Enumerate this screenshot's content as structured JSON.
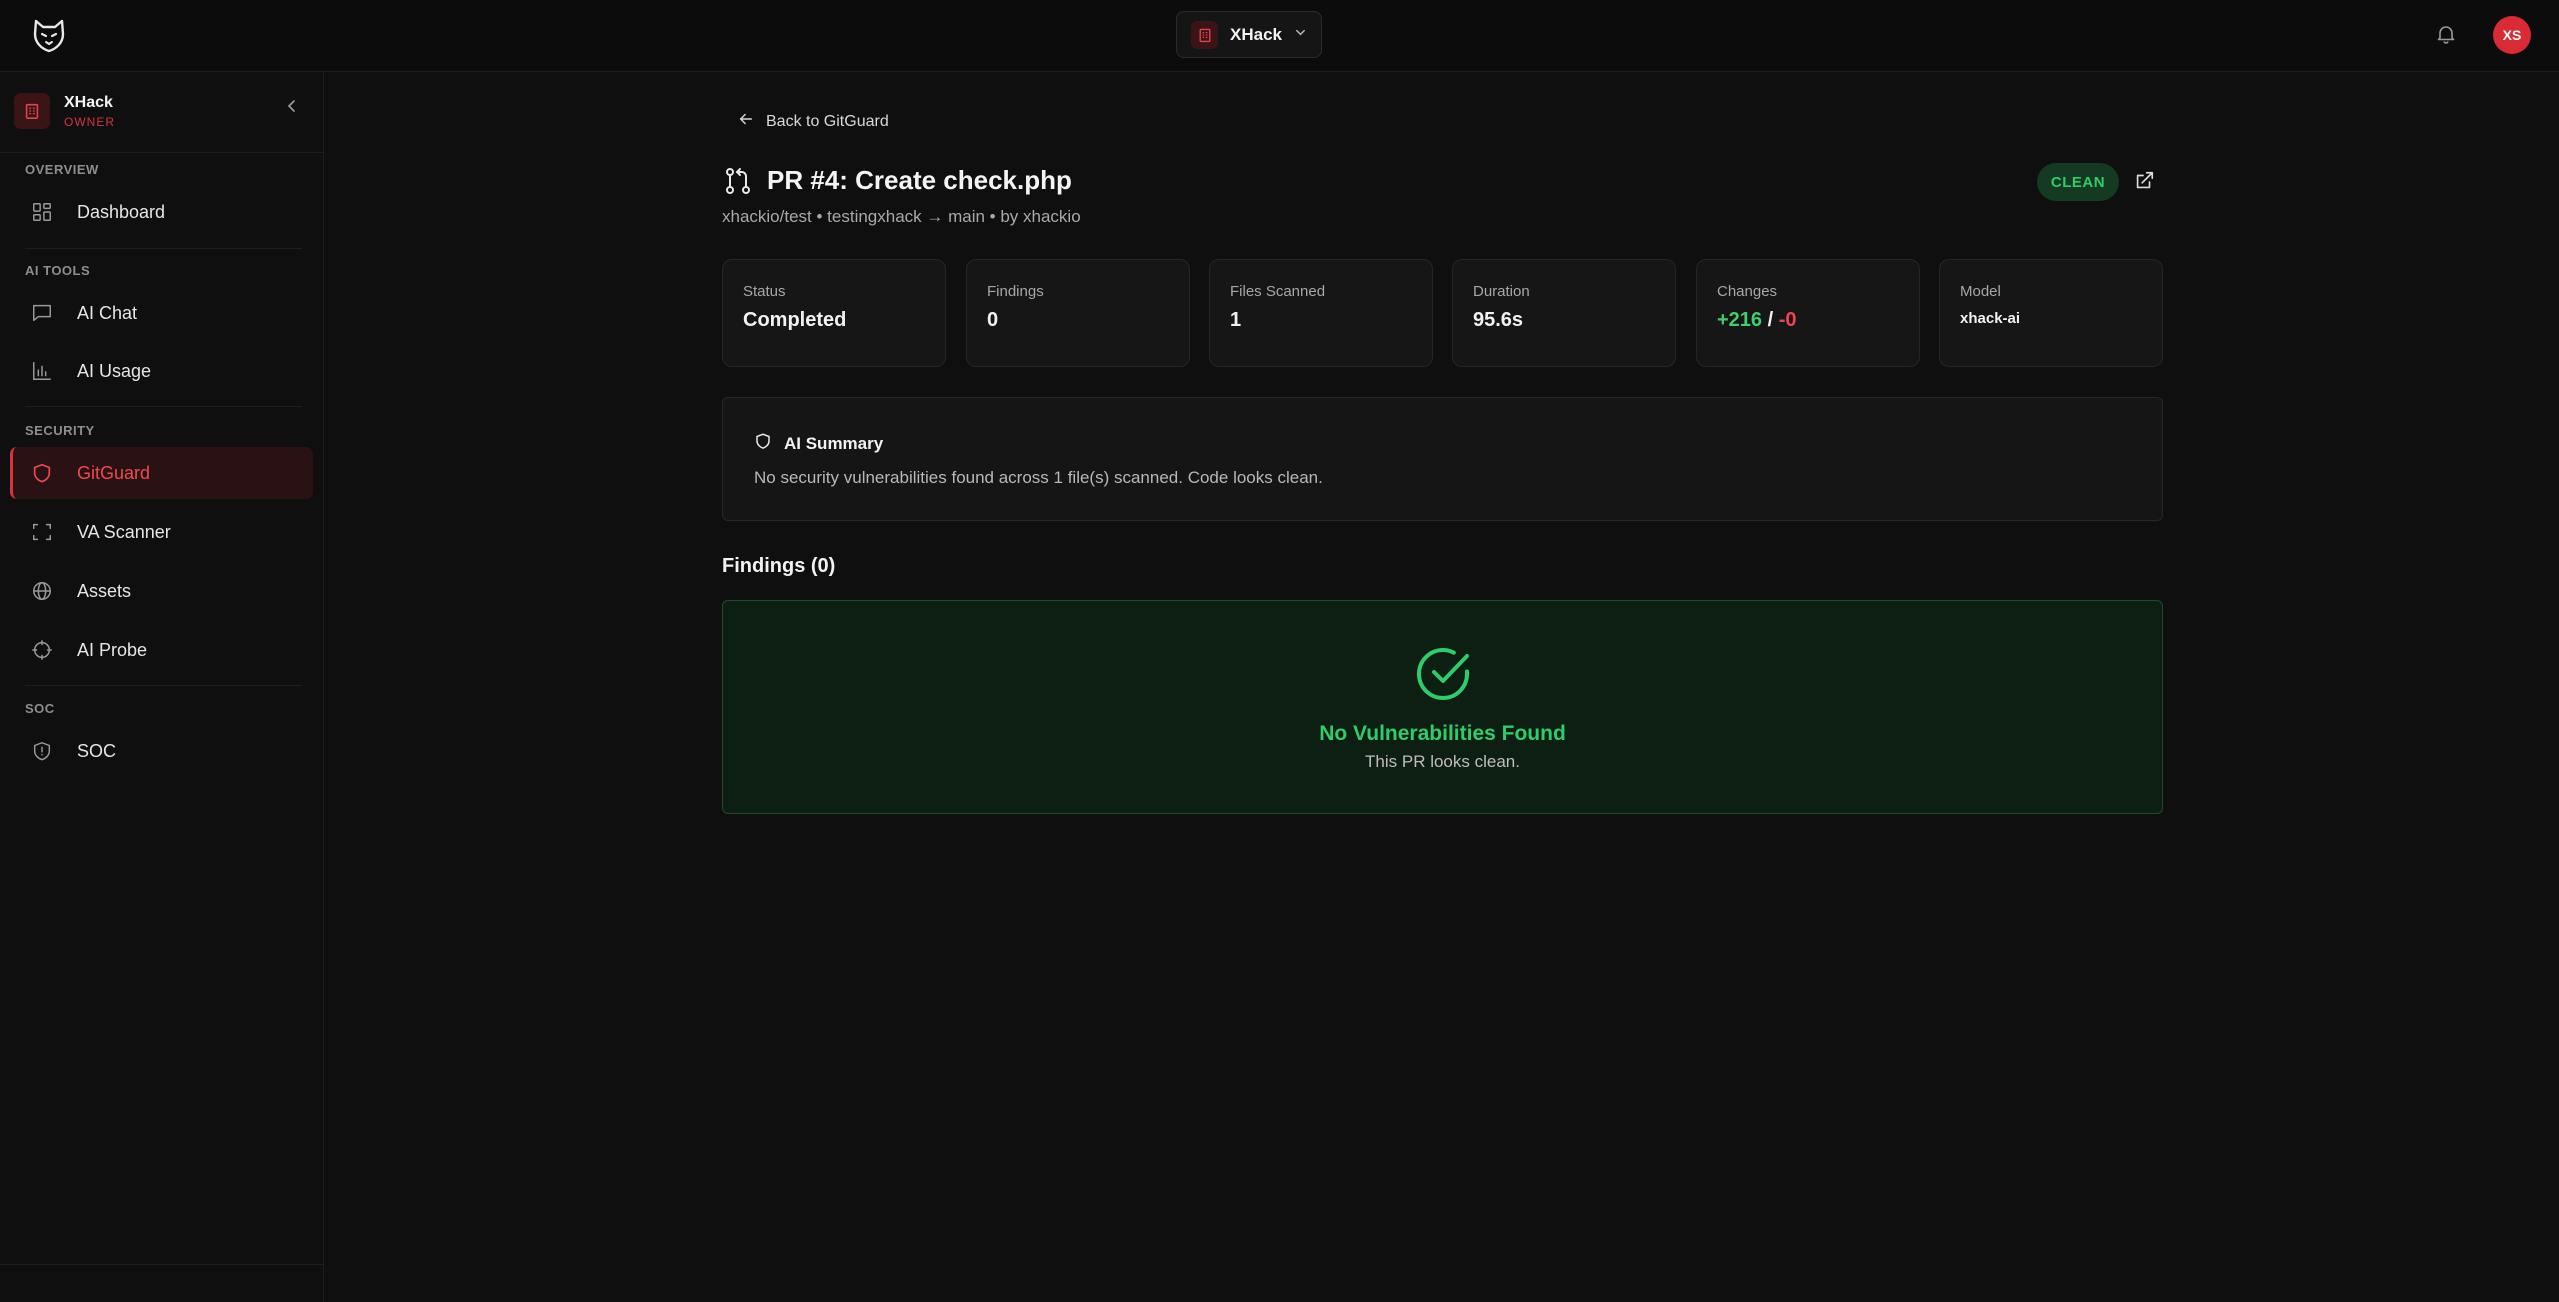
{
  "header": {
    "org_switcher": {
      "name": "XHack"
    },
    "user_initials": "XS"
  },
  "sidebar": {
    "workspace": {
      "name": "XHack",
      "role": "OWNER"
    },
    "sections": [
      {
        "label": "OVERVIEW",
        "items": [
          {
            "label": "Dashboard",
            "icon": "grid-icon"
          }
        ]
      },
      {
        "label": "AI TOOLS",
        "items": [
          {
            "label": "AI Chat",
            "icon": "chat-icon"
          },
          {
            "label": "AI Usage",
            "icon": "bar-chart-icon"
          }
        ]
      },
      {
        "label": "SECURITY",
        "items": [
          {
            "label": "GitGuard",
            "icon": "shield-icon",
            "active": true
          },
          {
            "label": "VA Scanner",
            "icon": "scan-icon"
          },
          {
            "label": "Assets",
            "icon": "globe-icon"
          },
          {
            "label": "AI Probe",
            "icon": "crosshair-icon"
          }
        ]
      },
      {
        "label": "SOC",
        "items": [
          {
            "label": "SOC",
            "icon": "shield-alert-icon"
          }
        ]
      }
    ]
  },
  "main": {
    "back_label": "Back to GitGuard",
    "pr_title": "PR #4: Create check.php",
    "pr_meta": "xhackio/test • testingxhack → main • by xhackio",
    "status_badge": "CLEAN",
    "stats": [
      {
        "label": "Status",
        "value": "Completed"
      },
      {
        "label": "Findings",
        "value": "0"
      },
      {
        "label": "Files Scanned",
        "value": "1"
      },
      {
        "label": "Duration",
        "value": "95.6s"
      },
      {
        "label": "Changes",
        "additions": "+216",
        "separator": "/",
        "deletions": "-0"
      },
      {
        "label": "Model",
        "value": "xhack-ai"
      }
    ],
    "ai_summary": {
      "title": "AI Summary",
      "text": "No security vulnerabilities found across 1 file(s) scanned. Code looks clean."
    },
    "findings": {
      "title": "Findings (0)",
      "empty_title": "No Vulnerabilities Found",
      "empty_subtitle": "This PR looks clean."
    }
  },
  "colors": {
    "accent": "#d9333b",
    "success": "#2fcc6b",
    "danger": "#ef4450",
    "background": "#0f0f0f"
  }
}
